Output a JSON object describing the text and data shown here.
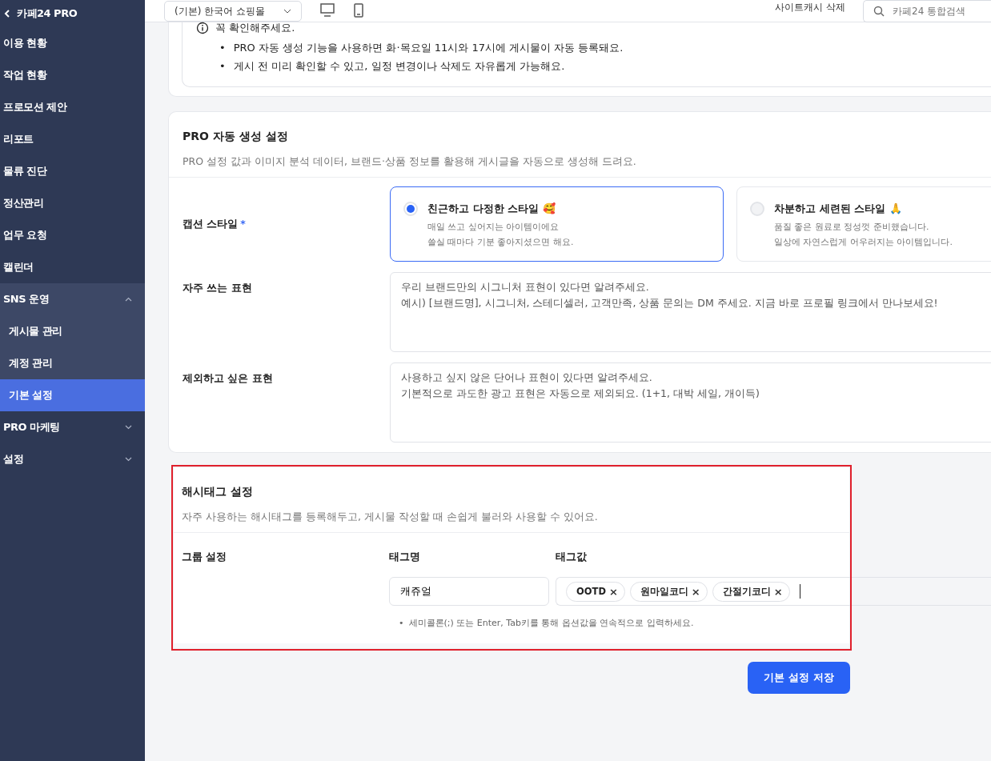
{
  "sidebar": {
    "title": "카페24 PRO",
    "items": [
      {
        "label": "이용 현황",
        "kind": "link",
        "selected": false
      },
      {
        "label": "작업 현황",
        "kind": "link",
        "selected": false
      },
      {
        "label": "프로모션 제안",
        "kind": "link",
        "selected": false
      },
      {
        "label": "리포트",
        "kind": "link",
        "selected": false
      },
      {
        "label": "물류 진단",
        "kind": "link",
        "selected": false
      },
      {
        "label": "정산관리",
        "kind": "link",
        "selected": false
      },
      {
        "label": "업무 요청",
        "kind": "link",
        "selected": false
      },
      {
        "label": "캘린더",
        "kind": "link",
        "selected": false
      },
      {
        "label": "SNS 운영",
        "kind": "group",
        "expanded": true,
        "children": [
          {
            "label": "게시물 관리",
            "selected": false
          },
          {
            "label": "계정 관리",
            "selected": false
          },
          {
            "label": "기본 설정",
            "selected": true
          }
        ]
      },
      {
        "label": "PRO 마케팅",
        "kind": "group",
        "expanded": false
      },
      {
        "label": "설정",
        "kind": "group",
        "expanded": false
      }
    ]
  },
  "header": {
    "shop_select": "(기본) 한국어 쇼핑몰",
    "cache_button": "사이트캐시 삭제",
    "search": {
      "placeholder": "카페24 통합검색"
    }
  },
  "notice": {
    "title": "꼭 확인해주세요.",
    "bullet_glyph": "•",
    "bullets": [
      "PRO 자동 생성 기능을 사용하면 화·목요일 11시와 17시에 게시물이 자동 등록돼요.",
      "게시 전 미리 확인할 수 있고, 일정 변경이나 삭제도 자유롭게 가능해요."
    ]
  },
  "auto_settings": {
    "title": "PRO 자동 생성 설정",
    "description": "PRO 설정 값과 이미지 분석 데이터, 브랜드·상품 정보를 활용해 게시글을 자동으로 생성해 드려요.",
    "caption_style": {
      "label": "캡션 스타일",
      "required_mark": "*",
      "options": [
        {
          "title": "친근하고 다정한 스타일 🥰",
          "lines": [
            "매일 쓰고 싶어지는 아이템이에요",
            "쓸실 때마다 기분 좋아지셨으면 해요."
          ],
          "selected": true
        },
        {
          "title": "차분하고 세련된 스타일 🙏",
          "lines": [
            "품질 좋은 원료로 정성껏 준비했습니다.",
            "일상에 자연스럽게 어우러지는 아이템입니다."
          ],
          "selected": false
        }
      ]
    },
    "fields": [
      {
        "label": "자주 쓰는 표현",
        "placeholder": "우리 브랜드만의 시그니처 표현이 있다면 알려주세요.\n예시) [브랜드명], 시그니처, 스테디셀러, 고객만족, 상품 문의는 DM 주세요. 지금 바로 프로필 링크에서 만나보세요!"
      },
      {
        "label": "제외하고 싶은 표현",
        "placeholder": "사용하고 싶지 않은 단어나 표현이 있다면 알려주세요.\n기본적으로 과도한 광고 표현은 자동으로 제외되요. (1+1, 대박 세일, 개이득)"
      }
    ]
  },
  "hashtag_settings": {
    "title": "해시태그 설정",
    "description": "자주 사용하는 해시태그를 등록해두고, 게시물 작성할 때 손쉽게 불러와 사용할 수 있어요.",
    "highlighted": true,
    "group_label": "그룹 설정",
    "name_heading": "태그명",
    "value_heading": "태그값",
    "tag_name": "캐쥬얼",
    "tags": [
      "OOTD",
      "원마일코디",
      "간절기코디"
    ],
    "remove_glyph": "×",
    "hint_glyph": "•",
    "hint": "세미콜론(;) 또는 Enter, Tab키를 통해 옵션값을 연속적으로 입력하세요."
  },
  "save_button": "기본 설정 저장"
}
